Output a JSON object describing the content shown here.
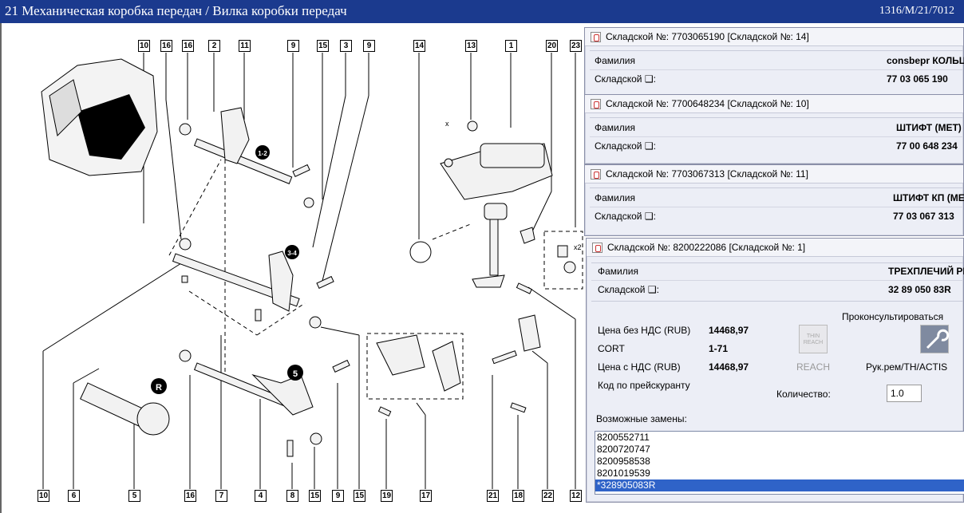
{
  "window": {
    "title": "21 Механическая коробка передач / Вилка коробки передач",
    "code": "1316/M/21/7012"
  },
  "callouts_top": [
    "10",
    "16",
    "16",
    "2",
    "11",
    "9",
    "15",
    "3",
    "9",
    "14",
    "13",
    "1",
    "20",
    "23"
  ],
  "callouts_bottom": [
    "10",
    "6",
    "5",
    "16",
    "7",
    "4",
    "8",
    "15",
    "9",
    "15",
    "19",
    "17",
    "21",
    "18",
    "22",
    "12"
  ],
  "diagram_labels": {
    "gear12": "1-2",
    "gear34": "3-4",
    "gear5": "5",
    "gearR": "R",
    "x2": "x2",
    "xmark": "x"
  },
  "popups": [
    {
      "header": "Складской №: 7703065190 [Складской №: 14]",
      "family_label": "Фамилия",
      "family": "consbepr КОЛЬЦ",
      "stock_label": "Складской ❑:",
      "stock": "77 03 065 190"
    },
    {
      "header": "Складской №: 7700648234 [Складской №: 10]",
      "family_label": "Фамилия",
      "family": "ШТИФТ (МЕТ)",
      "stock_label": "Складской ❑:",
      "stock": "77 00 648 234"
    },
    {
      "header": "Складской №: 7703067313 [Складской №: 11]",
      "family_label": "Фамилия",
      "family": "ШТИФТ КП (МЕТ",
      "stock_label": "Складской ❑:",
      "stock": "77 03 067 313"
    }
  ],
  "main_popup": {
    "header": "Складской №: 8200222086 [Складской №: 1]",
    "family_label": "Фамилия",
    "family": "ТРЕХПЛЕЧИЙ РЫ",
    "stock_label": "Складской ❑:",
    "stock": "32 89 050 83R",
    "consult": "Проконсультироваться",
    "price_net_label": "Цена без НДС (RUB)",
    "price_net": "14468,97",
    "cort_label": "CORT",
    "cort": "1-71",
    "price_vat_label": "Цена с НДС (RUB)",
    "price_vat": "14468,97",
    "pricecode_label": "Код по прейскуранту",
    "reach_label": "REACH",
    "reach_icon_text": "THIN REACH",
    "manual_label": "Рук.рем/TH/ACTIS",
    "qty_label": "Количество:",
    "qty": "1.0",
    "replacements_label": "Возможные замены:",
    "replacements": [
      "8200552711",
      "8200720747",
      "8200958538",
      "8201019539",
      "*328905083R"
    ]
  }
}
